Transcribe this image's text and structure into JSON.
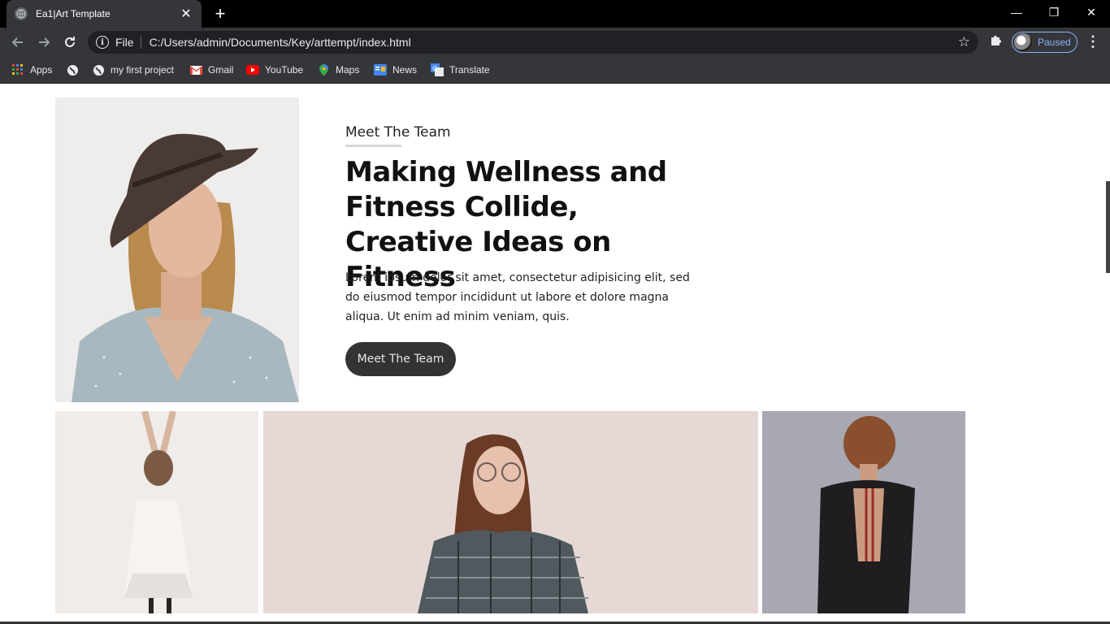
{
  "browser": {
    "tab_title": "Ea1|Art Template",
    "tab_close": "✕",
    "new_tab": "+",
    "omnibox_scheme": "File",
    "url": "C:/Users/admin/Documents/Key/arttempt/index.html",
    "profile_label": "Paused",
    "window_controls": [
      "—",
      "❐",
      "✕"
    ]
  },
  "bookmarks": [
    {
      "label": "Apps",
      "icon": "apps-grid-icon"
    },
    {
      "label": "",
      "icon": "globe-icon"
    },
    {
      "label": "my first project",
      "icon": "globe-icon"
    },
    {
      "label": "Gmail",
      "icon": "gmail-icon"
    },
    {
      "label": "YouTube",
      "icon": "youtube-icon"
    },
    {
      "label": "Maps",
      "icon": "maps-pin-icon"
    },
    {
      "label": "News",
      "icon": "news-icon"
    },
    {
      "label": "Translate",
      "icon": "translate-icon"
    }
  ],
  "hero": {
    "eyebrow": "Meet The Team",
    "headline": "Making Wellness and Fitness Collide, Creative Ideas on Fitness",
    "body": "Lorem ipsum dolor sit amet, consectetur adipisicing elit, sed do eiusmod tempor incididunt ut labore et dolore magna aliqua. Ut enim ad minim veniam, quis.",
    "cta": "Meet The Team"
  },
  "colors": {
    "chrome_dark": "#35363a",
    "tabbar": "#000000",
    "profile_accent": "#8ab4f8",
    "cta_bg": "#333333"
  }
}
